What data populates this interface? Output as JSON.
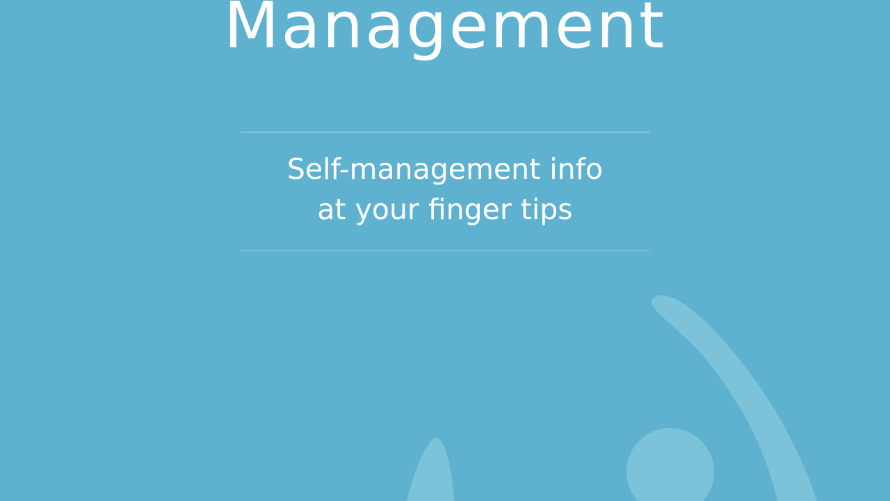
{
  "screen": {
    "title": "Management",
    "subtitle_lines": [
      "Self-management info",
      "at your finger tips"
    ]
  },
  "colors": {
    "background": "#5fb2cf",
    "text": "#ffffff",
    "divider": "#82c4dc",
    "decoration": "#7cc3da"
  },
  "decoration": {
    "icon": "person-figure-icon"
  }
}
